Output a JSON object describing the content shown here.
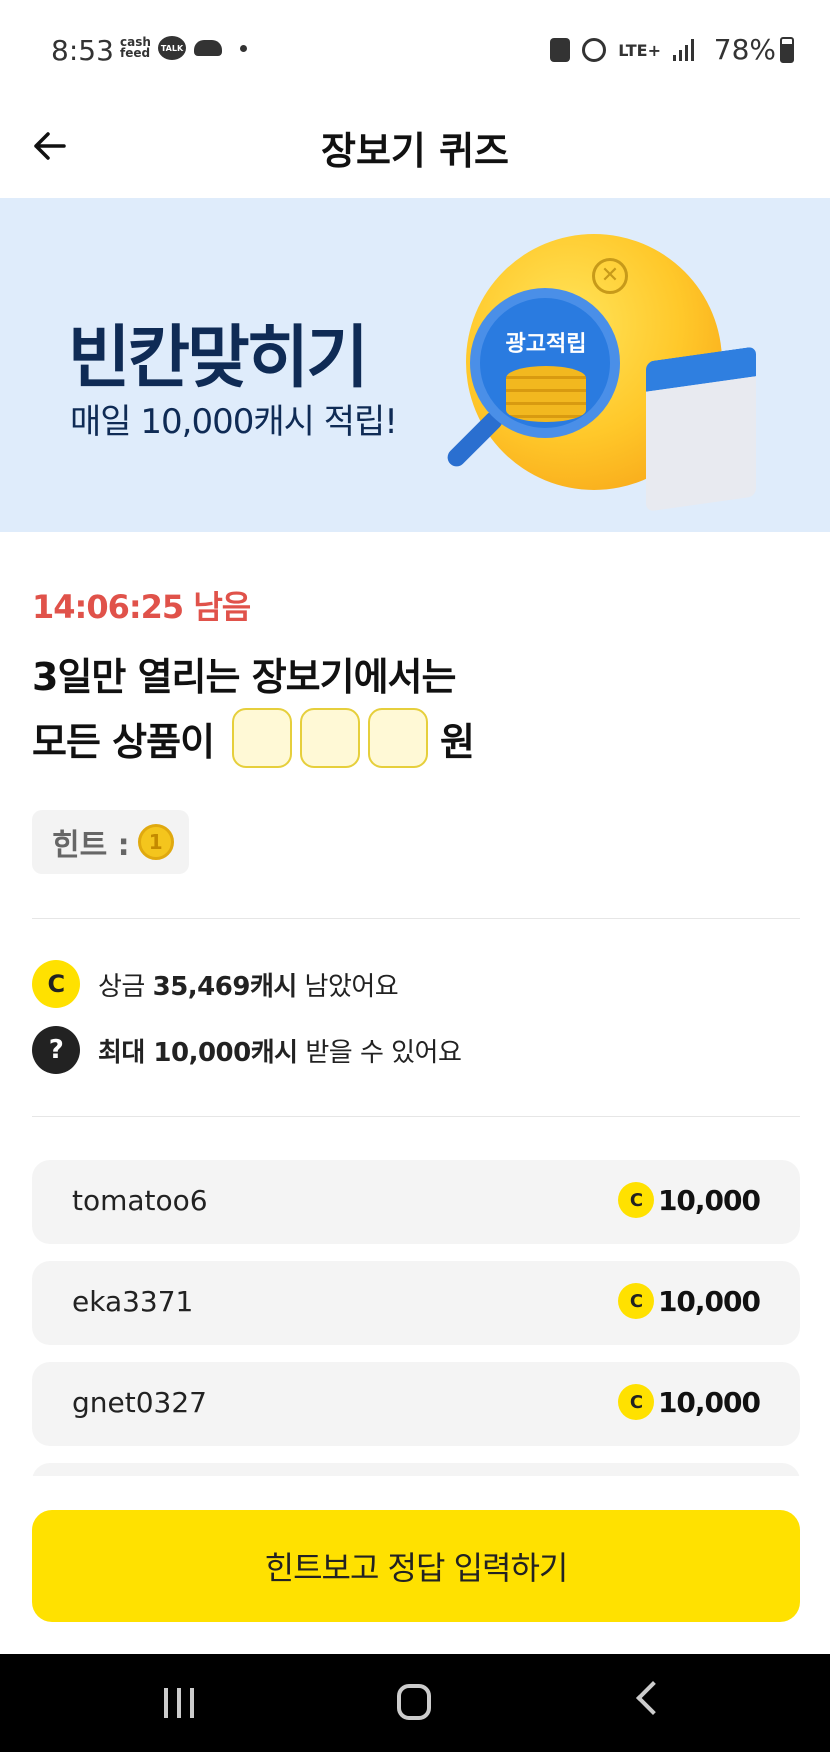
{
  "status_bar": {
    "time": "8:53",
    "cashfeed_label": "cash feed",
    "talk_label": "TALK",
    "network": "LTE+",
    "battery": "78%"
  },
  "header": {
    "title": "장보기 퀴즈"
  },
  "banner": {
    "title": "빈칸맞히기",
    "subtitle": "매일 10,000캐시 적립!",
    "badge": "광고적립"
  },
  "quiz": {
    "timer": "14:06:25 남음",
    "question_line1": "3일만 열리는 장보기에서는",
    "question_prefix": "모든 상품이",
    "question_suffix": "원",
    "answer_slots": 3,
    "hint_label": "힌트 :"
  },
  "info": {
    "prize_prefix": "상금 ",
    "prize_amount": "35,469캐시",
    "prize_suffix": " 남았어요",
    "max_amount": "최대 10,000캐시",
    "max_suffix": " 받을 수 있어요",
    "coin_symbol": "C",
    "question_symbol": "?"
  },
  "winners": [
    {
      "name": "tomatoo6",
      "amount": "10,000"
    },
    {
      "name": "eka3371",
      "amount": "10,000"
    },
    {
      "name": "gnet0327",
      "amount": "10,000"
    }
  ],
  "cta": {
    "label": "힌트보고 정답 입력하기"
  },
  "colors": {
    "accent_yellow": "#ffe100",
    "timer_red": "#e0524a",
    "banner_bg": "#dfecfb",
    "banner_text": "#0f2b55"
  }
}
